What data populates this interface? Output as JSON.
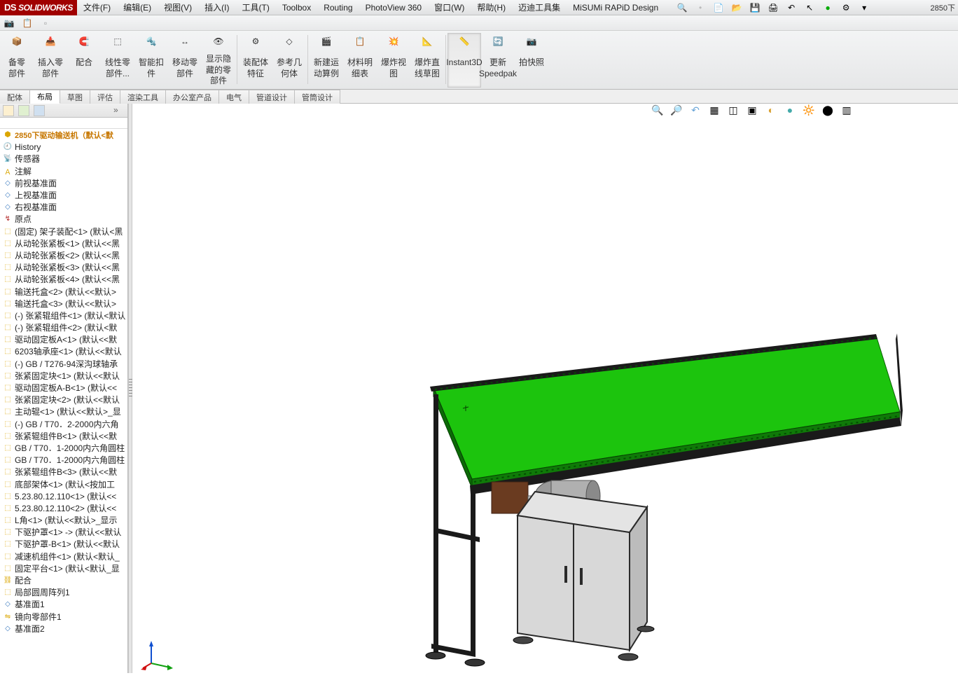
{
  "app": {
    "name": "SOLIDWORKS",
    "doc_title": "2850下"
  },
  "menus": [
    "文件(F)",
    "编辑(E)",
    "视图(V)",
    "插入(I)",
    "工具(T)",
    "Toolbox",
    "Routing",
    "PhotoView 360",
    "窗口(W)",
    "帮助(H)",
    "迈迪工具集",
    "MiSUMi RAPiD Design"
  ],
  "ribbon": [
    {
      "label": "备零\n部件"
    },
    {
      "label": "插入零\n部件"
    },
    {
      "label": "配合"
    },
    {
      "label": "线性零\n部件..."
    },
    {
      "label": "智能扣\n件"
    },
    {
      "label": "移动零\n部件"
    },
    {
      "label": "显示隐\n藏的零\n部件"
    },
    {
      "label": "装配体\n特征"
    },
    {
      "label": "参考几\n何体"
    },
    {
      "label": "新建运\n动算例"
    },
    {
      "label": "材料明\n细表"
    },
    {
      "label": "爆炸视\n图"
    },
    {
      "label": "爆炸直\n线草图"
    },
    {
      "label": "Instant3D",
      "active": true
    },
    {
      "label": "更新\nSpeedpak"
    },
    {
      "label": "拍快照"
    }
  ],
  "tabs": [
    "配体",
    "布局",
    "草图",
    "评估",
    "渲染工具",
    "办公室产品",
    "电气",
    "管道设计",
    "管筒设计"
  ],
  "tree": {
    "root": "2850下驱动输送机（默认<默",
    "items": [
      {
        "icon": "hist",
        "label": "History"
      },
      {
        "icon": "sens",
        "label": "传感器"
      },
      {
        "icon": "ann",
        "label": "注解"
      },
      {
        "icon": "plane",
        "label": "前视基准面"
      },
      {
        "icon": "plane",
        "label": "上视基准面"
      },
      {
        "icon": "plane",
        "label": "右视基准面"
      },
      {
        "icon": "origin",
        "label": "原点"
      },
      {
        "icon": "part",
        "label": "(固定) 架子装配<1> (默认<黑"
      },
      {
        "icon": "part",
        "label": "从动轮张紧板<1> (默认<<黑"
      },
      {
        "icon": "part",
        "label": "从动轮张紧板<2> (默认<<黑"
      },
      {
        "icon": "part",
        "label": "从动轮张紧板<3> (默认<<黑"
      },
      {
        "icon": "part",
        "label": "从动轮张紧板<4> (默认<<黑"
      },
      {
        "icon": "part",
        "label": "输送托盒<2> (默认<<默认>"
      },
      {
        "icon": "part",
        "label": "输送托盒<3> (默认<<默认>"
      },
      {
        "icon": "part",
        "label": "(-) 张紧辊组件<1> (默认<默认"
      },
      {
        "icon": "part",
        "label": "(-) 张紧辊组件<2> (默认<默"
      },
      {
        "icon": "part",
        "label": "驱动固定板A<1> (默认<<默"
      },
      {
        "icon": "part",
        "label": "6203轴承座<1> (默认<<默认"
      },
      {
        "icon": "part",
        "label": "(-) GB / T276-94深沟球轴承"
      },
      {
        "icon": "part",
        "label": "张紧固定块<1> (默认<<默认"
      },
      {
        "icon": "part",
        "label": "驱动固定板A-B<1> (默认<<"
      },
      {
        "icon": "part",
        "label": "张紧固定块<2> (默认<<默认"
      },
      {
        "icon": "part",
        "label": "主动辊<1> (默认<<默认>_显"
      },
      {
        "icon": "part",
        "label": "(-) GB / T70．2-2000内六角"
      },
      {
        "icon": "part",
        "label": "张紧辊组件B<1> (默认<<默"
      },
      {
        "icon": "part",
        "label": "GB / T70．1-2000内六角圆柱"
      },
      {
        "icon": "part",
        "label": "GB / T70．1-2000内六角圆柱"
      },
      {
        "icon": "part",
        "label": "张紧辊组件B<3> (默认<<默"
      },
      {
        "icon": "part",
        "label": "底部架体<1> (默认<按加工"
      },
      {
        "icon": "part",
        "label": "5.23.80.12.110<1> (默认<<"
      },
      {
        "icon": "part",
        "label": "5.23.80.12.110<2> (默认<<"
      },
      {
        "icon": "part",
        "label": "L角<1> (默认<<默认>_显示"
      },
      {
        "icon": "part",
        "label": "下驱护罩<1> -> (默认<<默认"
      },
      {
        "icon": "part",
        "label": "下驱护罩-B<1> (默认<<默认"
      },
      {
        "icon": "part",
        "label": "减速机组件<1> (默认<默认_"
      },
      {
        "icon": "part",
        "label": "固定平台<1> (默认<默认_显"
      },
      {
        "icon": "mate",
        "label": "配合"
      },
      {
        "icon": "patt",
        "label": "局部圆周阵列1"
      },
      {
        "icon": "plane",
        "label": "基准面1"
      },
      {
        "icon": "mirr",
        "label": "镜向零部件1"
      },
      {
        "icon": "plane",
        "label": "基准面2"
      }
    ]
  },
  "colors": {
    "surface": "#1cc40d",
    "cabinet": "#c8c8c8",
    "cabinet_edge": "#2a2a2a",
    "frame": "#1a1a1a"
  }
}
